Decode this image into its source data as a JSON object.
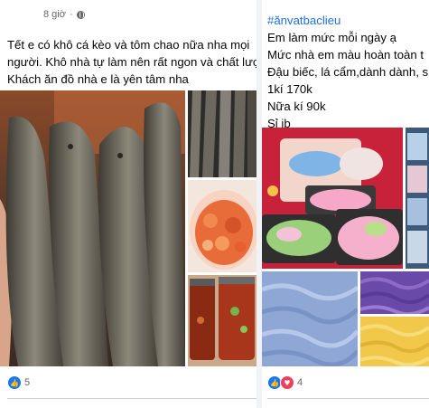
{
  "post_a": {
    "timestamp": "8 giờ",
    "lines": [
      "Tết e có khô cá kèo và tôm chao nữa nha mọi",
      "người. Khô nhà tự làm nên rất ngon và chất lượn",
      "Khách ăn đồ nhà e là yên tâm nha"
    ],
    "reaction_count": "5",
    "reaction_icons": [
      "like-icon"
    ]
  },
  "post_b": {
    "hashtag": "#ănvatbaclieu",
    "lines": [
      "Em làm mức mỗi ngày ạ",
      "Mức nhà em màu hoàn toàn t",
      "Đậu biếc, lá cẩm,dành dành, s",
      "1kí 170k",
      "Nữa kí 90k",
      "Sỉ ib"
    ],
    "reaction_count": "4",
    "reaction_icons": [
      "like-icon",
      "love-icon"
    ]
  },
  "colors": {
    "link": "#216fdb",
    "text": "#050505",
    "secondary": "#65676b",
    "like": "#1877f2",
    "love": "#f33e58"
  }
}
